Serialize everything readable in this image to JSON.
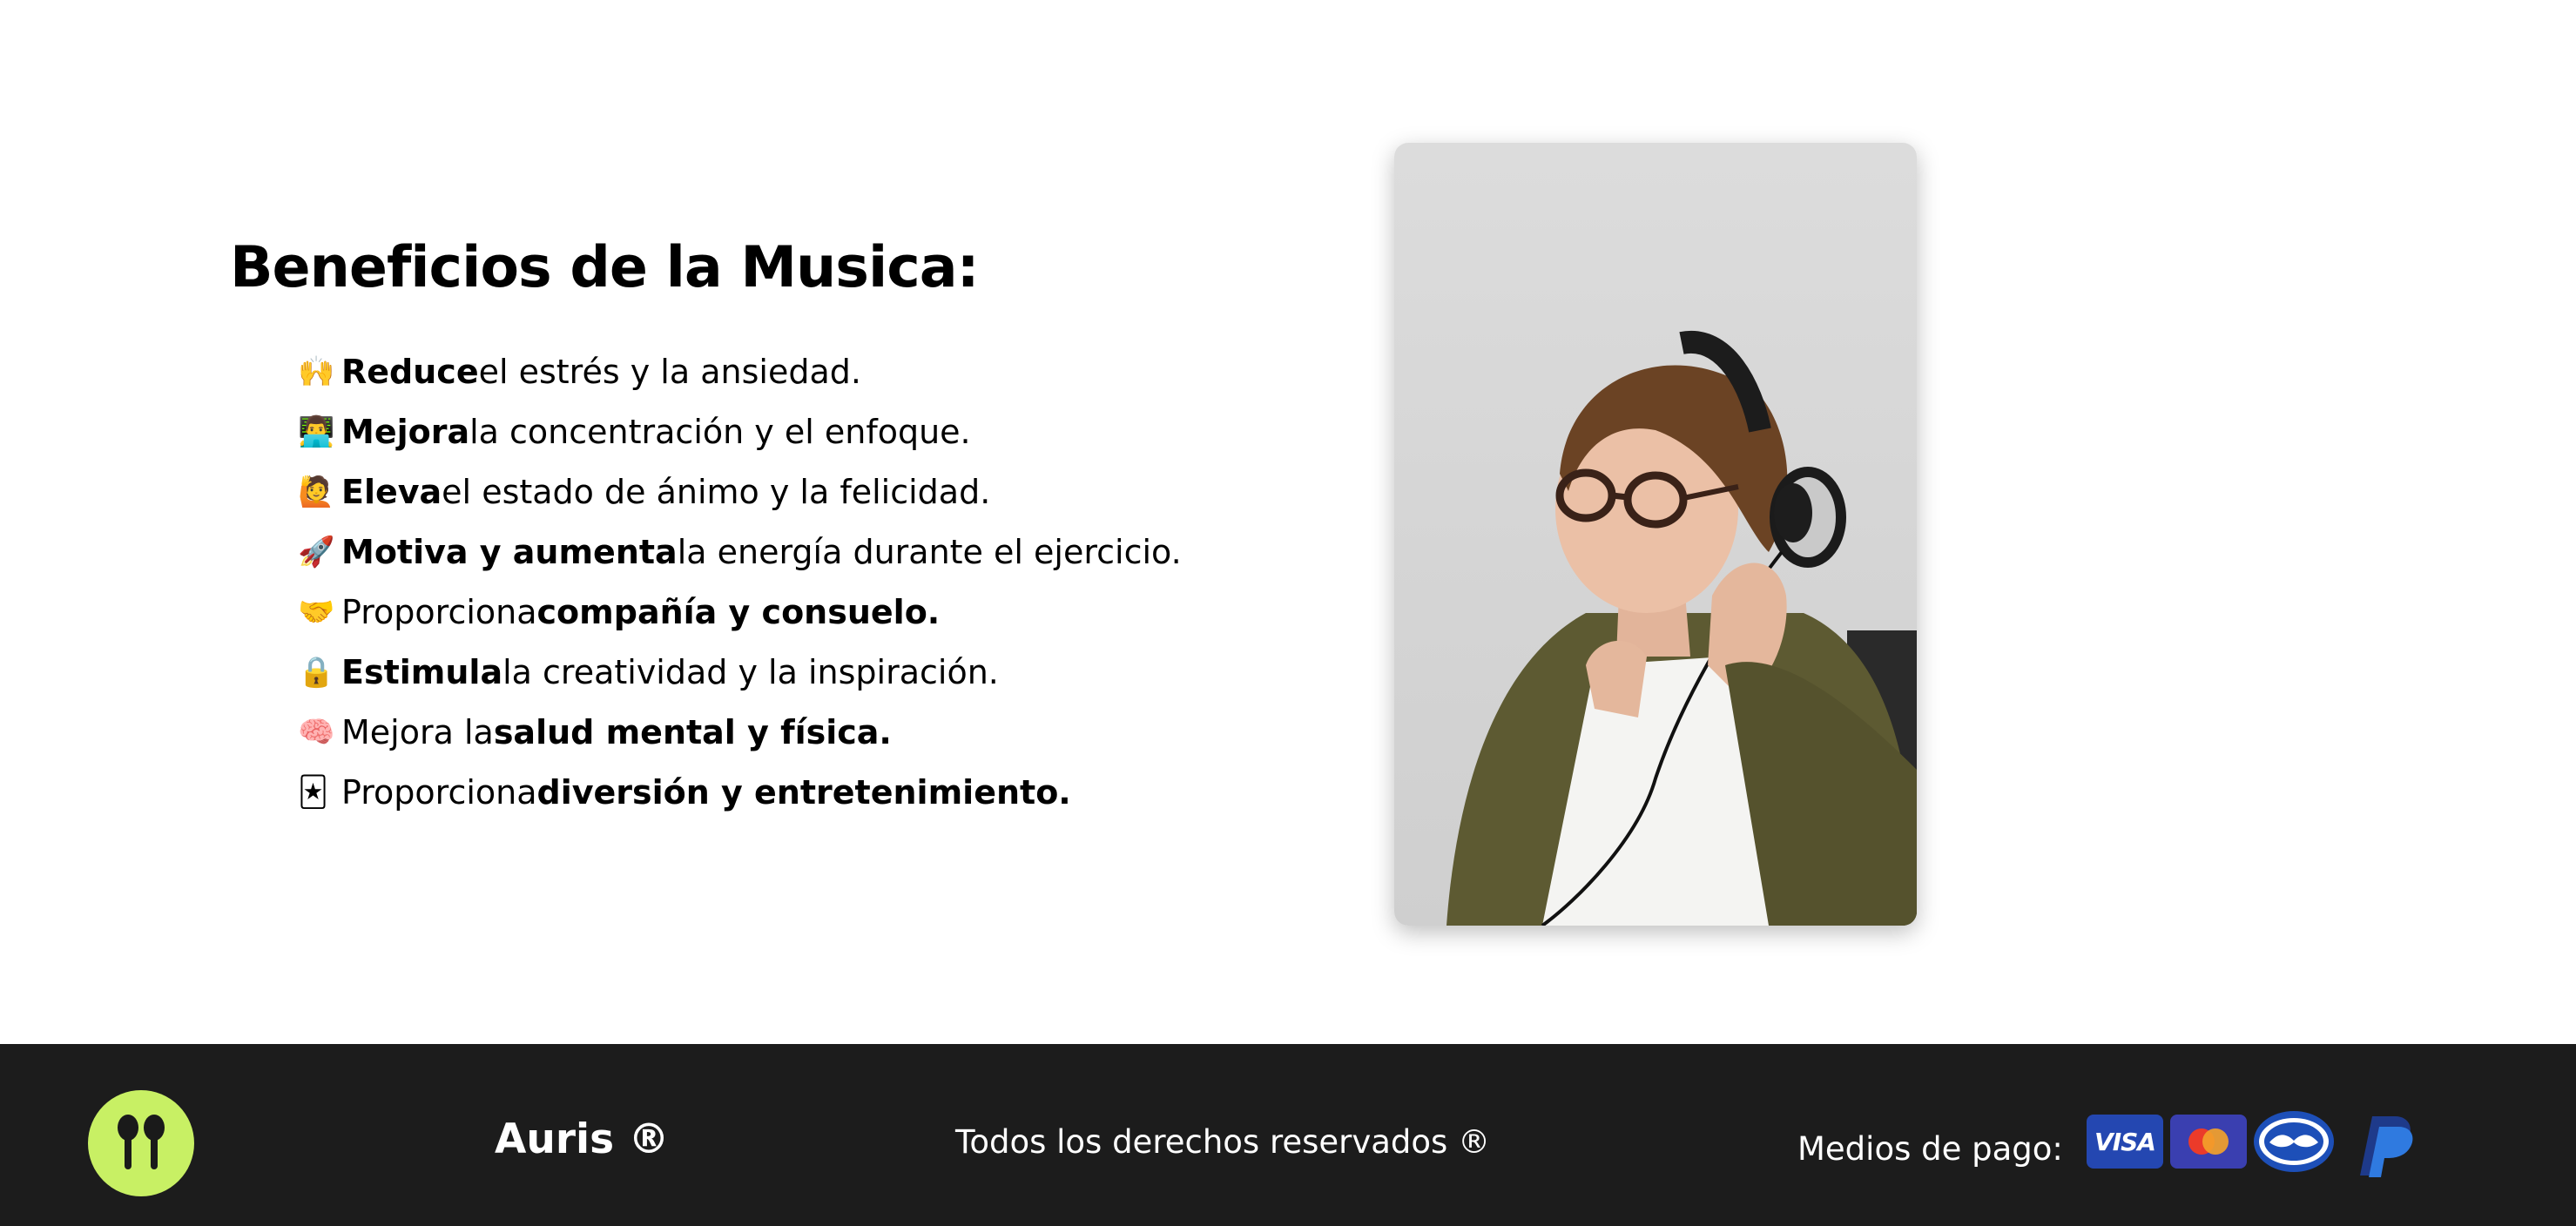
{
  "main": {
    "heading": "Beneficios de la Musica:",
    "benefits": [
      {
        "emoji": "🙌",
        "a": "",
        "b": "Reduce",
        "c": " el estrés y la ansiedad."
      },
      {
        "emoji": "👨‍💻",
        "a": "",
        "b": "Mejora",
        "c": " la concentración y el enfoque."
      },
      {
        "emoji": "🙋",
        "a": "",
        "b": "Eleva",
        "c": " el estado de ánimo y la felicidad."
      },
      {
        "emoji": "🚀",
        "a": "",
        "b": "Motiva y aumenta",
        "c": " la energía durante el ejercicio."
      },
      {
        "emoji": "🤝",
        "a": "Proporciona ",
        "b": "compañía y consuelo.",
        "c": ""
      },
      {
        "emoji": "🔒",
        "a": "",
        "b": "Estimula",
        "c": " la creatividad y la inspiración."
      },
      {
        "emoji": "🧠",
        "a": "Mejora la ",
        "b": "salud mental y física.",
        "c": ""
      },
      {
        "emoji": "🃏",
        "a": "Proporciona ",
        "b": "diversión y entretenimiento.",
        "c": ""
      }
    ],
    "photo_icon": "woman-with-headphones-photo"
  },
  "footer": {
    "brand": "Auris ®",
    "rights": "Todos los derechos reservados ®",
    "payments_label": "Medios de pago:",
    "logo_icon": "earbuds-icon",
    "logo_color": "#c8f064",
    "payment_icons": [
      "visa-icon",
      "mastercard-icon",
      "mercadopago-icon",
      "paypal-icon"
    ],
    "visa_text": "VISA"
  }
}
